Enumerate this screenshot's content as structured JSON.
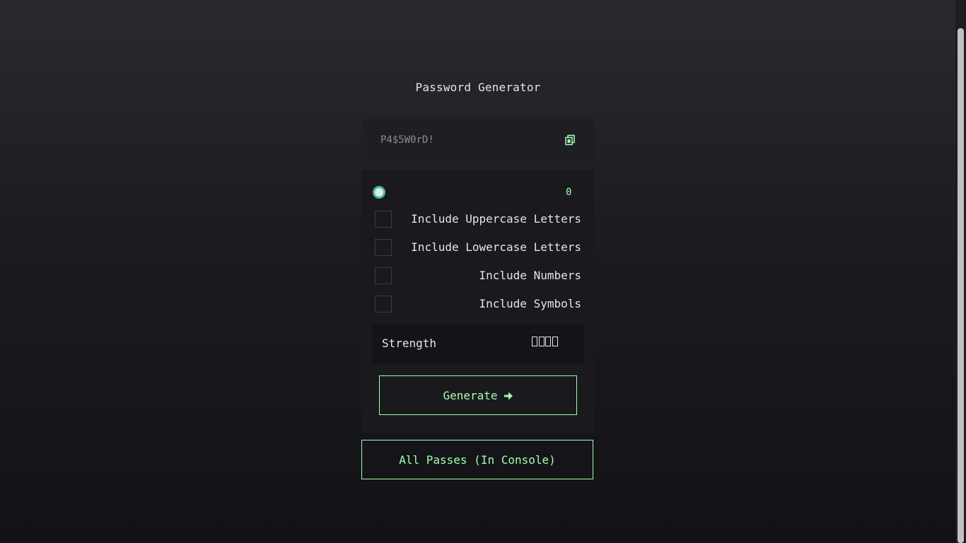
{
  "app": {
    "title": "Password Generator"
  },
  "output": {
    "password": "P4$5W0rD!",
    "copy_icon": "copy-icon"
  },
  "length": {
    "value": "0",
    "slider_level": 0
  },
  "options": [
    {
      "label": "Include Uppercase Letters",
      "checked": false
    },
    {
      "label": "Include Lowercase Letters",
      "checked": false
    },
    {
      "label": "Include Numbers",
      "checked": false
    },
    {
      "label": "Include Symbols",
      "checked": false
    }
  ],
  "strength": {
    "label": "Strength",
    "bars_filled": 0,
    "bars_total": 4
  },
  "buttons": {
    "generate": "Generate",
    "generate_icon": "arrow-right-icon",
    "all_passes": "All Passes (In Console)"
  },
  "colors": {
    "accent": "#a4ffaf",
    "slider_border": "#3fbfa0",
    "text": "#e6e5ea",
    "muted": "#8c8b92"
  }
}
